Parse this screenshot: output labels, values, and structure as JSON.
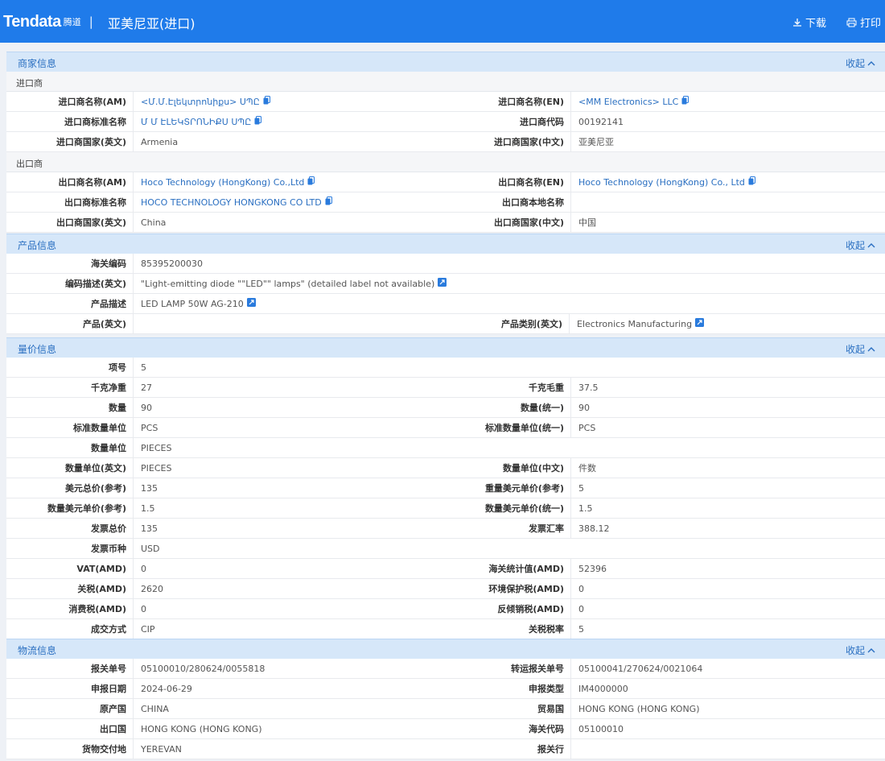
{
  "header": {
    "logo": "Tendata",
    "logo_cn": "腾道",
    "separator": "|",
    "title": "亚美尼亚(进口)",
    "download": "下载",
    "print": "打印"
  },
  "collapse_label": "收起",
  "sections": {
    "merchant": {
      "title": "商家信息",
      "importer_sub": "进口商",
      "exporter_sub": "出口商",
      "importer": [
        [
          "进口商名称(AM)",
          "<Մ.Մ.Էլեկտրոնիքս> ՍՊԸ",
          "进口商名称(EN)",
          "<MM Electronics> LLC"
        ],
        [
          "进口商标准名称",
          "Մ Մ ԷԼԵԿՏՐՈՆԻՔՍ ՍՊԸ",
          "进口商代码",
          "00192141"
        ],
        [
          "进口商国家(英文)",
          "Armenia",
          "进口商国家(中文)",
          "亚美尼亚"
        ]
      ],
      "exporter": [
        [
          "出口商名称(AM)",
          "Hoco Technology (HongKong) Co.,Ltd",
          "出口商名称(EN)",
          "Hoco Technology (HongKong) Co., Ltd"
        ],
        [
          "出口商标准名称",
          "HOCO TECHNOLOGY HONGKONG CO LTD",
          "出口商本地名称",
          ""
        ],
        [
          "出口商国家(英文)",
          "China",
          "出口商国家(中文)",
          "中国"
        ]
      ]
    },
    "product": {
      "title": "产品信息",
      "hs_code_label": "海关编码",
      "hs_code": "85395200030",
      "hs_desc_label": "编码描述(英文)",
      "hs_desc": "\"Light-emitting diode \"\"LED\"\" lamps\" (detailed label not available)",
      "desc_label": "产品描述",
      "desc": "LED LAMP 50W AG-210",
      "prod_en_label": "产品(英文)",
      "prod_en": "",
      "category_label": "产品类别(英文)",
      "category": "Electronics Manufacturing"
    },
    "price": {
      "title": "量价信息",
      "rows": [
        [
          "项号",
          "5"
        ],
        [
          "千克净重",
          "27",
          "千克毛重",
          "37.5"
        ],
        [
          "数量",
          "90",
          "数量(统一)",
          "90"
        ],
        [
          "标准数量单位",
          "PCS",
          "标准数量单位(统一)",
          "PCS"
        ],
        [
          "数量单位",
          "PIECES"
        ],
        [
          "数量单位(英文)",
          "PIECES",
          "数量单位(中文)",
          "件数"
        ],
        [
          "美元总价(参考)",
          "135",
          "重量美元单价(参考)",
          "5"
        ],
        [
          "数量美元单价(参考)",
          "1.5",
          "数量美元单价(统一)",
          "1.5"
        ],
        [
          "发票总价",
          "135",
          "发票汇率",
          "388.12"
        ],
        [
          "发票币种",
          "USD"
        ],
        [
          "VAT(AMD)",
          "0",
          "海关统计值(AMD)",
          "52396"
        ],
        [
          "关税(AMD)",
          "2620",
          "环境保护税(AMD)",
          "0"
        ],
        [
          "消费税(AMD)",
          "0",
          "反倾销税(AMD)",
          "0"
        ],
        [
          "成交方式",
          "CIP",
          "关税税率",
          "5"
        ]
      ]
    },
    "logistics": {
      "title": "物流信息",
      "rows": [
        [
          "报关单号",
          "05100010/280624/0055818",
          "转运报关单号",
          "05100041/270624/0021064"
        ],
        [
          "申报日期",
          "2024-06-29",
          "申报类型",
          "IM4000000"
        ],
        [
          "原产国",
          "CHINA",
          "贸易国",
          "HONG KONG (HONG KONG)"
        ],
        [
          "出口国",
          "HONG KONG (HONG KONG)",
          "海关代码",
          "05100010"
        ],
        [
          "货物交付地",
          "YEREVAN",
          "报关行",
          ""
        ]
      ]
    }
  },
  "colors": {
    "header_bg": "#1f7bea",
    "section_bg": "#d6e7f9",
    "link": "#2a6fc1"
  },
  "icons": {
    "copy": "copy-icon",
    "translate": "translate-icon",
    "download": "download-icon",
    "print": "print-icon",
    "chevron": "chevron-up-icon"
  }
}
